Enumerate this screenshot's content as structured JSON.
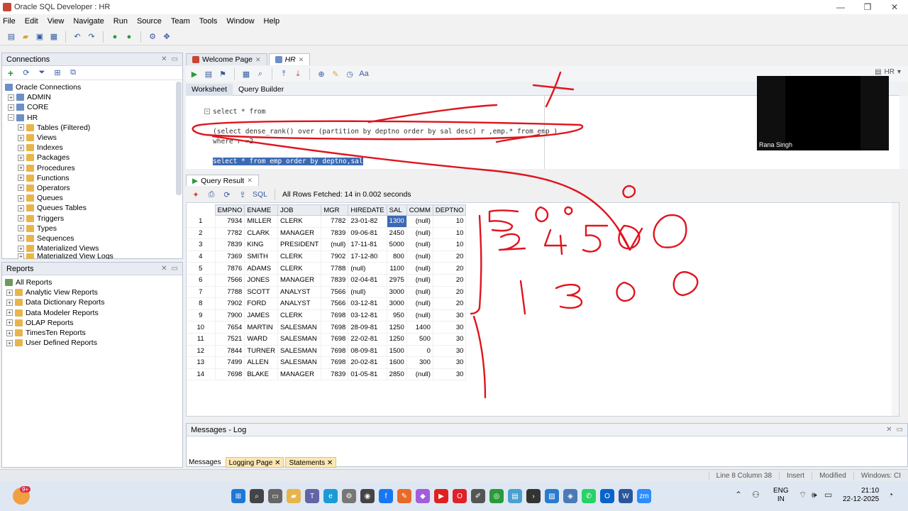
{
  "window": {
    "title": "Oracle SQL Developer : HR",
    "controls": [
      "—",
      "❐",
      "✕"
    ]
  },
  "menu": [
    "File",
    "Edit",
    "View",
    "Navigate",
    "Run",
    "Source",
    "Team",
    "Tools",
    "Window",
    "Help"
  ],
  "connections": {
    "title": "Connections",
    "root": "Oracle Connections",
    "items": [
      "ADMIN",
      "CORE",
      "HR"
    ],
    "hr_children": [
      "Tables (Filtered)",
      "Views",
      "Indexes",
      "Packages",
      "Procedures",
      "Functions",
      "Operators",
      "Queues",
      "Queues Tables",
      "Triggers",
      "Types",
      "Sequences",
      "Materialized Views",
      "Materialized View Logs"
    ]
  },
  "reports": {
    "title": "Reports",
    "root": "All Reports",
    "items": [
      "Analytic View Reports",
      "Data Dictionary Reports",
      "Data Modeler Reports",
      "OLAP Reports",
      "TimesTen Reports",
      "User Defined Reports"
    ]
  },
  "editor_tabs": [
    {
      "label": "Welcome Page"
    },
    {
      "label": "HR"
    }
  ],
  "worksheet_tabs": [
    "Worksheet",
    "Query Builder"
  ],
  "connection_selector": "HR",
  "sql_lines": [
    "select * from",
    "(select dense_rank() over (partition by deptno order by sal desc) r ,emp.* from emp )",
    "where r =2",
    "select * from emp order by deptno,sal"
  ],
  "query_result": {
    "tab": "Query Result",
    "sql_label": "SQL",
    "status": "All Rows Fetched: 14 in 0.002 seconds",
    "columns": [
      "EMPNO",
      "ENAME",
      "JOB",
      "MGR",
      "HIREDATE",
      "SAL",
      "COMM",
      "DEPTNO"
    ],
    "rows": [
      [
        "1",
        "7934",
        "MILLER",
        "CLERK",
        "7782",
        "23-01-82",
        "1300",
        "(null)",
        "10"
      ],
      [
        "2",
        "7782",
        "CLARK",
        "MANAGER",
        "7839",
        "09-06-81",
        "2450",
        "(null)",
        "10"
      ],
      [
        "3",
        "7839",
        "KING",
        "PRESIDENT",
        "(null)",
        "17-11-81",
        "5000",
        "(null)",
        "10"
      ],
      [
        "4",
        "7369",
        "SMITH",
        "CLERK",
        "7902",
        "17-12-80",
        "800",
        "(null)",
        "20"
      ],
      [
        "5",
        "7876",
        "ADAMS",
        "CLERK",
        "7788",
        "(null)",
        "1100",
        "(null)",
        "20"
      ],
      [
        "6",
        "7566",
        "JONES",
        "MANAGER",
        "7839",
        "02-04-81",
        "2975",
        "(null)",
        "20"
      ],
      [
        "7",
        "7788",
        "SCOTT",
        "ANALYST",
        "7566",
        "(null)",
        "3000",
        "(null)",
        "20"
      ],
      [
        "8",
        "7902",
        "FORD",
        "ANALYST",
        "7566",
        "03-12-81",
        "3000",
        "(null)",
        "20"
      ],
      [
        "9",
        "7900",
        "JAMES",
        "CLERK",
        "7698",
        "03-12-81",
        "950",
        "(null)",
        "30"
      ],
      [
        "10",
        "7654",
        "MARTIN",
        "SALESMAN",
        "7698",
        "28-09-81",
        "1250",
        "1400",
        "30"
      ],
      [
        "11",
        "7521",
        "WARD",
        "SALESMAN",
        "7698",
        "22-02-81",
        "1250",
        "500",
        "30"
      ],
      [
        "12",
        "7844",
        "TURNER",
        "SALESMAN",
        "7698",
        "08-09-81",
        "1500",
        "0",
        "30"
      ],
      [
        "13",
        "7499",
        "ALLEN",
        "SALESMAN",
        "7698",
        "20-02-81",
        "1600",
        "300",
        "30"
      ],
      [
        "14",
        "7698",
        "BLAKE",
        "MANAGER",
        "7839",
        "01-05-81",
        "2850",
        "(null)",
        "30"
      ]
    ]
  },
  "messages": {
    "title": "Messages - Log",
    "tabs": [
      "Messages",
      "Logging Page",
      "Statements"
    ]
  },
  "statusbar": [
    "Line 8 Column 38",
    "Insert",
    "Modified",
    "Windows: CI"
  ],
  "webcam": {
    "name": "Rana Singh"
  },
  "handwriting": [
    "2450",
    "1300",
    "0",
    "0"
  ],
  "taskbar": {
    "lang": "ENG",
    "region": "IN",
    "time": "21:10",
    "date": "22-12-2025",
    "badge": "9+"
  },
  "colors": {
    "accent": "#3b6ab5",
    "ink": "#e0141e",
    "tabHighlight": "#fbe7b4"
  }
}
